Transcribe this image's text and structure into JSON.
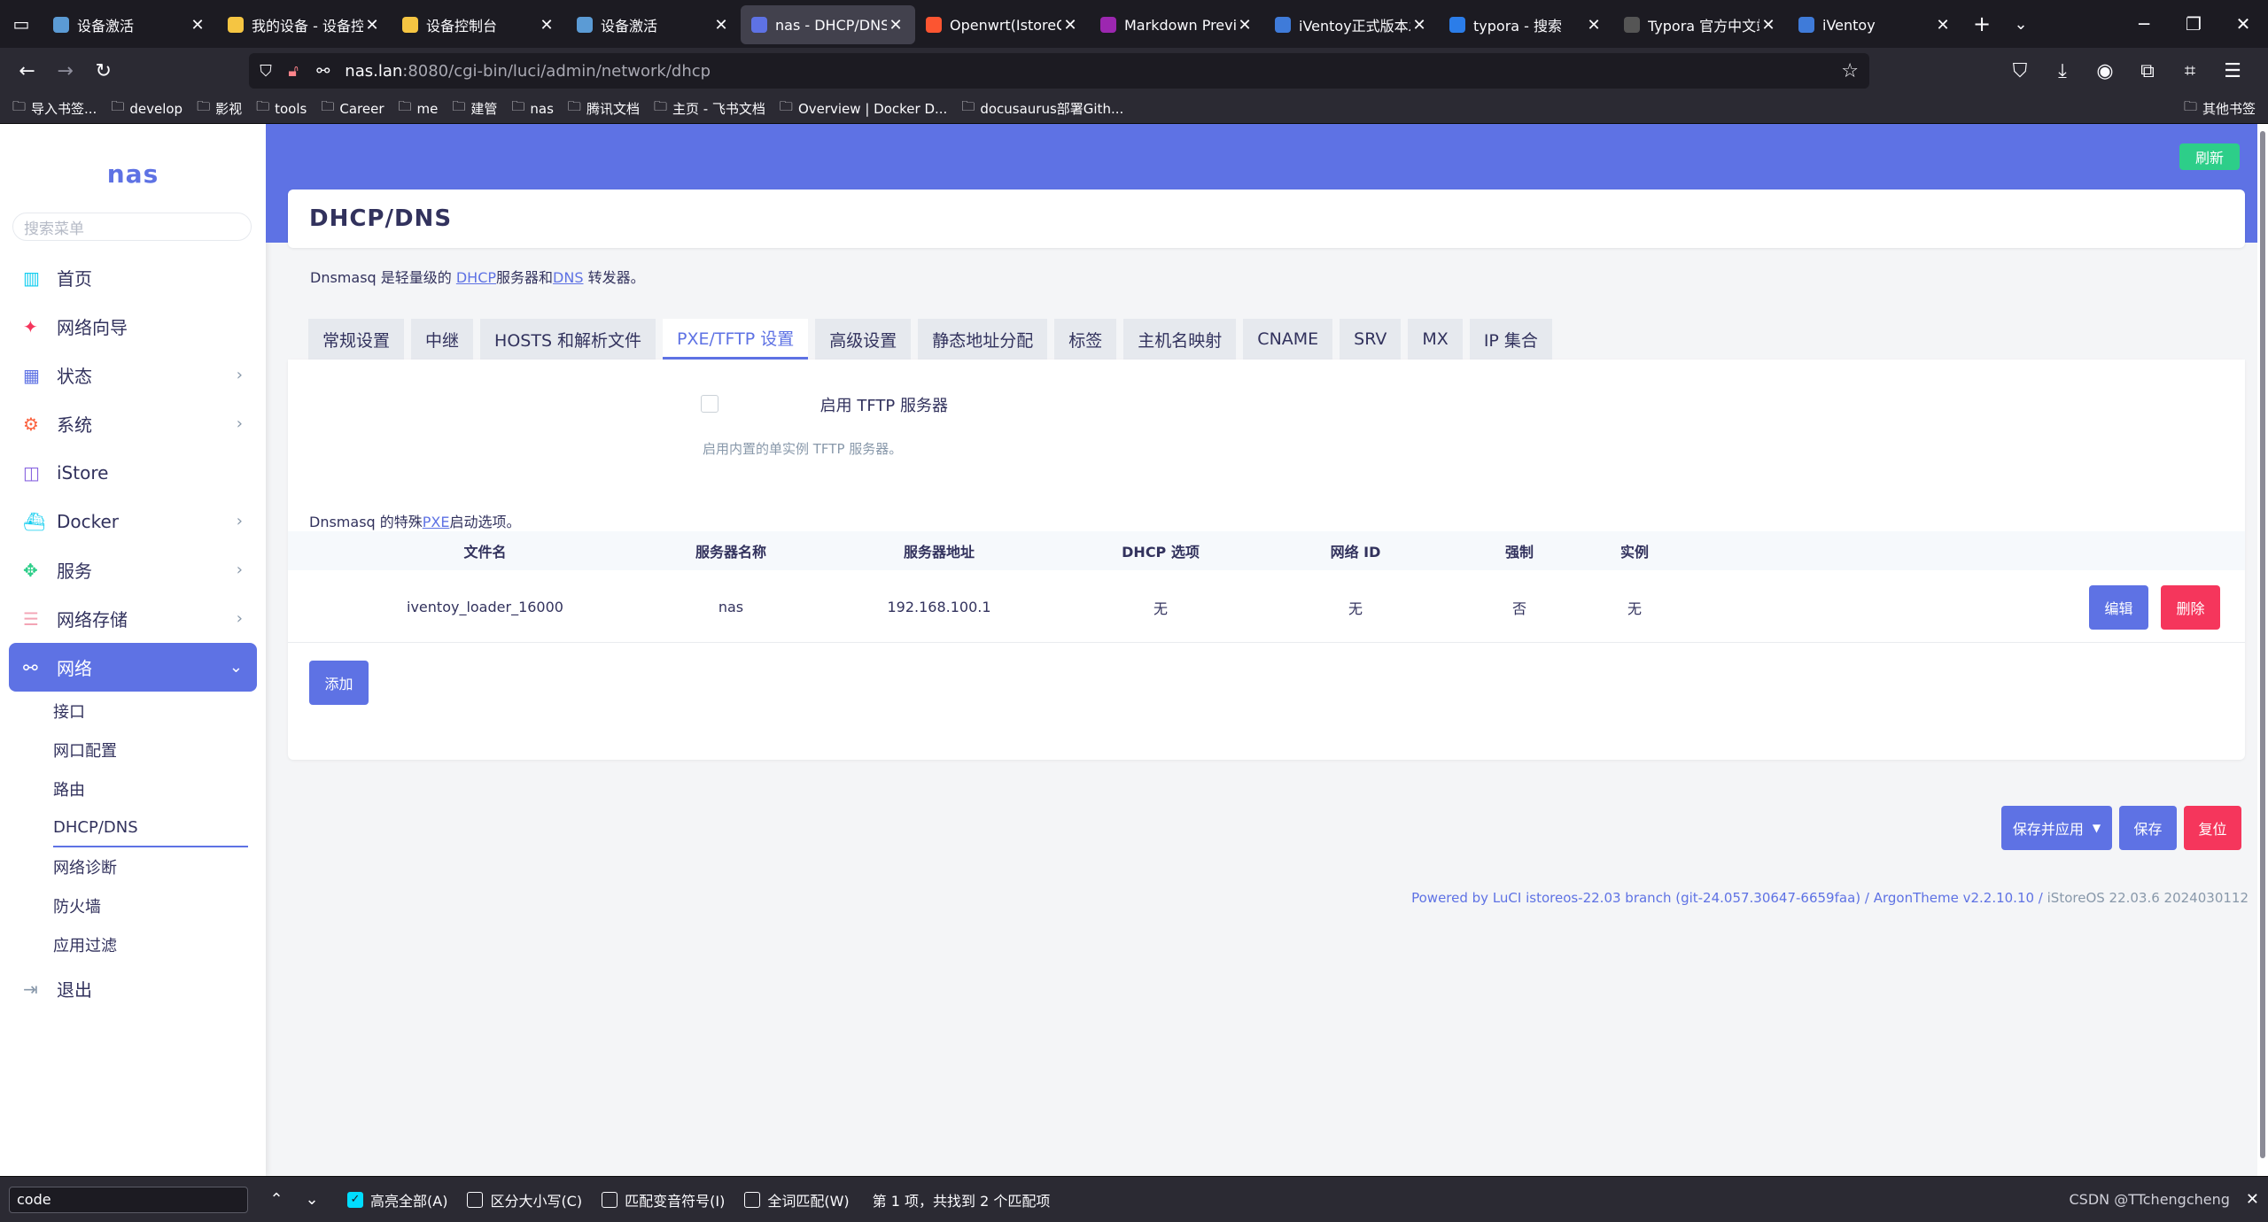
{
  "browser": {
    "tabs": [
      {
        "title": "设备激活",
        "favicon": "istore-icon",
        "color": "#5b9bd5"
      },
      {
        "title": "我的设备 - 设备控制台",
        "favicon": "cloud-icon",
        "color": "#f5c542"
      },
      {
        "title": "设备控制台",
        "favicon": "cloud-icon",
        "color": "#f5c542"
      },
      {
        "title": "设备激活",
        "favicon": "istore-icon",
        "color": "#5b9bd5"
      },
      {
        "title": "nas - DHCP/DNS - LuCI",
        "favicon": "luci-icon",
        "color": "#5e72e4"
      },
      {
        "title": "Openwrt(IstoreOS)",
        "favicon": "csdn-icon",
        "color": "#fc5531"
      },
      {
        "title": "Markdown Preview",
        "favicon": "markdown-icon",
        "color": "#9c27b0"
      },
      {
        "title": "iVentoy正式版本发布",
        "favicon": "iventoy-icon",
        "color": "#3f7bd9"
      },
      {
        "title": "typora - 搜索",
        "favicon": "search-icon",
        "color": "#2b7de9"
      },
      {
        "title": "Typora 官方中文站",
        "favicon": "typora-icon",
        "color": "#555"
      },
      {
        "title": "iVentoy",
        "favicon": "iventoy-icon",
        "color": "#3f7bd9"
      }
    ],
    "active_tab_index": 4,
    "url_host": "nas.lan",
    "url_path": ":8080/cgi-bin/luci/admin/network/dhcp",
    "bookmarks": [
      "导入书签...",
      "develop",
      "影视",
      "tools",
      "Career",
      "me",
      "建管",
      "nas",
      "腾讯文档",
      "主页 - 飞书文档",
      "Overview | Docker D...",
      "docusaurus部署Gith..."
    ],
    "other_bookmarks": "其他书签"
  },
  "sidebar": {
    "logo": "nas",
    "search_placeholder": "搜索菜单",
    "items": [
      {
        "label": "首页",
        "icon": "chart-icon",
        "color": "#11cdef",
        "chevron": false
      },
      {
        "label": "网络向导",
        "icon": "wizard-icon",
        "color": "#f5365c",
        "chevron": false
      },
      {
        "label": "状态",
        "icon": "grid-icon",
        "color": "#5e72e4",
        "chevron": true
      },
      {
        "label": "系统",
        "icon": "gear-icon",
        "color": "#fb6340",
        "chevron": true
      },
      {
        "label": "iStore",
        "icon": "store-icon",
        "color": "#8965e0",
        "chevron": false
      },
      {
        "label": "Docker",
        "icon": "docker-icon",
        "color": "#11cdef",
        "chevron": true
      },
      {
        "label": "服务",
        "icon": "puzzle-icon",
        "color": "#2dce89",
        "chevron": true
      },
      {
        "label": "网络存储",
        "icon": "storage-icon",
        "color": "#f3a4b5",
        "chevron": true
      },
      {
        "label": "网络",
        "icon": "network-icon",
        "color": "#ffffff",
        "chevron": true
      }
    ],
    "sub_items": [
      "接口",
      "网口配置",
      "路由",
      "DHCP/DNS",
      "网络诊断",
      "防火墙",
      "应用过滤"
    ],
    "active_sub": "DHCP/DNS",
    "logout": "退出"
  },
  "header": {
    "refresh_badge": "刷新"
  },
  "page": {
    "title": "DHCP/DNS",
    "desc_prefix": "Dnsmasq 是轻量级的 ",
    "desc_dhcp": "DHCP",
    "desc_mid": "服务器和",
    "desc_dns": "DNS",
    "desc_suffix": " 转发器。",
    "tabs": [
      "常规设置",
      "中继",
      "HOSTS 和解析文件",
      "PXE/TFTP 设置",
      "高级设置",
      "静态地址分配",
      "标签",
      "主机名映射",
      "CNAME",
      "SRV",
      "MX",
      "IP 集合"
    ],
    "active_tab": "PXE/TFTP 设置",
    "tftp_label": "启用 TFTP 服务器",
    "tftp_enabled": false,
    "tftp_hint": "启用内置的单实例 TFTP 服务器。",
    "pxe_desc_prefix": "Dnsmasq 的特殊",
    "pxe_desc_link": "PXE",
    "pxe_desc_suffix": "启动选项。",
    "table": {
      "headers": [
        "文件名",
        "服务器名称",
        "服务器地址",
        "DHCP 选项",
        "网络 ID",
        "强制",
        "实例"
      ],
      "rows": [
        [
          "iventoy_loader_16000",
          "nas",
          "192.168.100.1",
          "无",
          "无",
          "否",
          "无"
        ]
      ],
      "edit_label": "编辑",
      "delete_label": "删除"
    },
    "add_label": "添加",
    "save_apply_label": "保存并应用",
    "save_label": "保存",
    "reset_label": "复位"
  },
  "footer": {
    "text": "Powered by LuCI istoreos-22.03 branch (git-24.057.30647-6659faa) / ArgonTheme v2.2.10.10 / ",
    "version": "iStoreOS 22.03.6 2024030112"
  },
  "findbar": {
    "query": "code",
    "highlight_all": "高亮全部(A)",
    "highlight_all_checked": true,
    "match_case": "区分大小写(C)",
    "match_diacritics": "匹配变音符号(I)",
    "whole_words": "全词匹配(W)",
    "status": "第 1 项，共找到 2 个匹配项",
    "watermark": "CSDN @TTchengcheng"
  }
}
